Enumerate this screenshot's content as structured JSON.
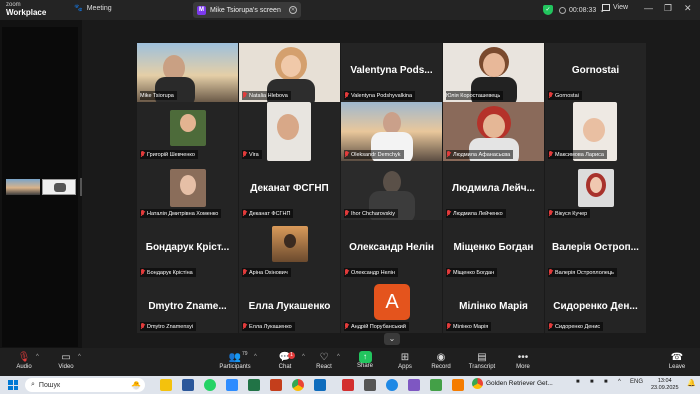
{
  "app": {
    "brand_line1": "zoom",
    "brand_line2": "Workplace"
  },
  "topbar": {
    "meeting_tab": "Meeting",
    "share_tab_badge": "M",
    "share_tab": "Mike Tsiorupa's screen",
    "timer": "00:08:33",
    "view": "View"
  },
  "grid": {
    "row1": [
      {
        "label": "Mike Tsiorupa",
        "big": ""
      },
      {
        "label": "Natalia Hlebova",
        "big": ""
      },
      {
        "label": "Valentyna Podshyvalkina",
        "big": "Valentyna Pods..."
      },
      {
        "label": "Юлія Коросташевець",
        "big": ""
      },
      {
        "label": "Gornostai",
        "big": "Gornostai"
      }
    ],
    "row2": [
      {
        "label": "Григорій Шевченко",
        "big": ""
      },
      {
        "label": "Vira",
        "big": ""
      },
      {
        "label": "Oleksandr Demchyk",
        "big": ""
      },
      {
        "label": "Людмила Афанасьєва",
        "big": ""
      },
      {
        "label": "Максимова Лариса",
        "big": ""
      }
    ],
    "row3": [
      {
        "label": "Наталія Дмитрівна Хоменко",
        "big": ""
      },
      {
        "label": "Деканат ФСГНП",
        "big": "Деканат ФСГНП"
      },
      {
        "label": "Ihor Chcharovskiy",
        "big": ""
      },
      {
        "label": "Людмила Лейченко",
        "big": "Людмила Лейч..."
      },
      {
        "label": "Вікуся Кучер",
        "big": ""
      }
    ],
    "row4": [
      {
        "label": "Бондарук Крістіна",
        "big": "Бондарук Кріст..."
      },
      {
        "label": "Аріна Охінович",
        "big": ""
      },
      {
        "label": "Олександр Нелін",
        "big": "Олександр Нелін"
      },
      {
        "label": "Міщенко Богдан",
        "big": "Міщенко Богдан"
      },
      {
        "label": "Валерія Остроплолець",
        "big": "Валерія Остроп..."
      }
    ],
    "row5": [
      {
        "label": "Dmytro Znamensyi",
        "big": "Dmytro Zname..."
      },
      {
        "label": "Елла Лукашенко",
        "big": "Елла Лукашенко"
      },
      {
        "label": "Андрій Порубанський",
        "big": "",
        "avatar": "A"
      },
      {
        "label": "Мілінко Марія",
        "big": "Мілінко Марія"
      },
      {
        "label": "Сидоренко Денис",
        "big": "Сидоренко Ден..."
      }
    ]
  },
  "toolbar": {
    "audio": "Audio",
    "video": "Video",
    "participants": "Participants",
    "participants_count": "79",
    "chat": "Chat",
    "chat_badge": "1",
    "react": "React",
    "share": "Share",
    "apps": "Apps",
    "record": "Record",
    "transcript": "Transcript",
    "more": "More",
    "leave": "Leave"
  },
  "taskbar": {
    "search_placeholder": "Пошук",
    "active_window": "Golden Retriever Get...",
    "lang": "ENG",
    "time": "13:04",
    "date": "23.09.2025"
  },
  "colors": {
    "speaking_border": "#2ecc71",
    "muted_mic": "#e23b3b",
    "share_green": "#22c55e",
    "avatar_orange": "#e4541d"
  }
}
